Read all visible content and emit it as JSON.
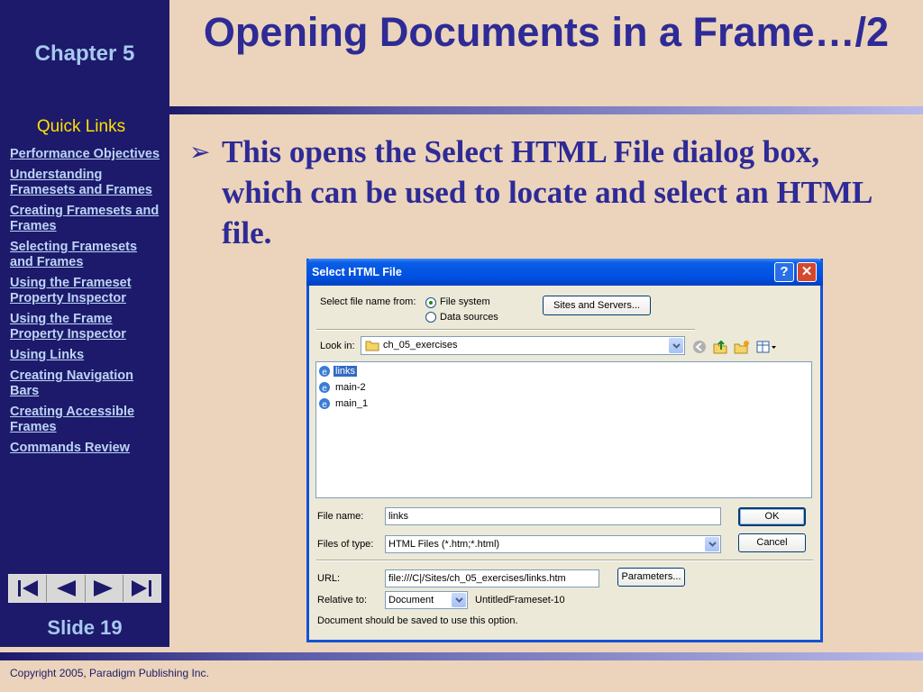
{
  "sidebar": {
    "chapter": "Chapter 5",
    "quick_links_title": "Quick Links",
    "links": [
      "Performance Objectives",
      "Understanding Framesets and Frames",
      "Creating Framesets and Frames",
      "Selecting Framesets and Frames",
      "Using the Frameset Property Inspector",
      "Using the Frame Property Inspector",
      "Using Links",
      "Creating Navigation Bars",
      "Creating Accessible Frames",
      "Commands Review"
    ],
    "slide": "Slide 19"
  },
  "slide": {
    "title": "Opening Documents in a Frame…/2",
    "bullet": "This opens the Select HTML File dialog box, which can be used to locate and select an HTML file.",
    "copyright": "Copyright 2005, Paradigm Publishing Inc."
  },
  "dialog": {
    "title": "Select HTML File",
    "select_from_label": "Select file name from:",
    "radio_file_system": "File system",
    "radio_data_sources": "Data sources",
    "sites_button": "Sites and Servers...",
    "look_in_label": "Look in:",
    "look_in_value": "ch_05_exercises",
    "files": [
      {
        "name": "links",
        "selected": true
      },
      {
        "name": "main-2",
        "selected": false
      },
      {
        "name": "main_1",
        "selected": false
      }
    ],
    "file_name_label": "File name:",
    "file_name_value": "links",
    "files_of_type_label": "Files of type:",
    "files_of_type_value": "HTML Files (*.htm;*.html)",
    "ok_button": "OK",
    "cancel_button": "Cancel",
    "url_label": "URL:",
    "url_value": "file:///C|/Sites/ch_05_exercises/links.htm",
    "parameters_button": "Parameters...",
    "relative_to_label": "Relative to:",
    "relative_to_value": "Document",
    "relative_to_doc": "UntitledFrameset-10",
    "note": "Document should be saved to use this option."
  },
  "colors": {
    "sidebar": "#1D1A6B",
    "title": "#2E2A96",
    "background": "#EBD4BB",
    "quick_links": "#FFE000",
    "xp_blue": "#0050E0"
  }
}
